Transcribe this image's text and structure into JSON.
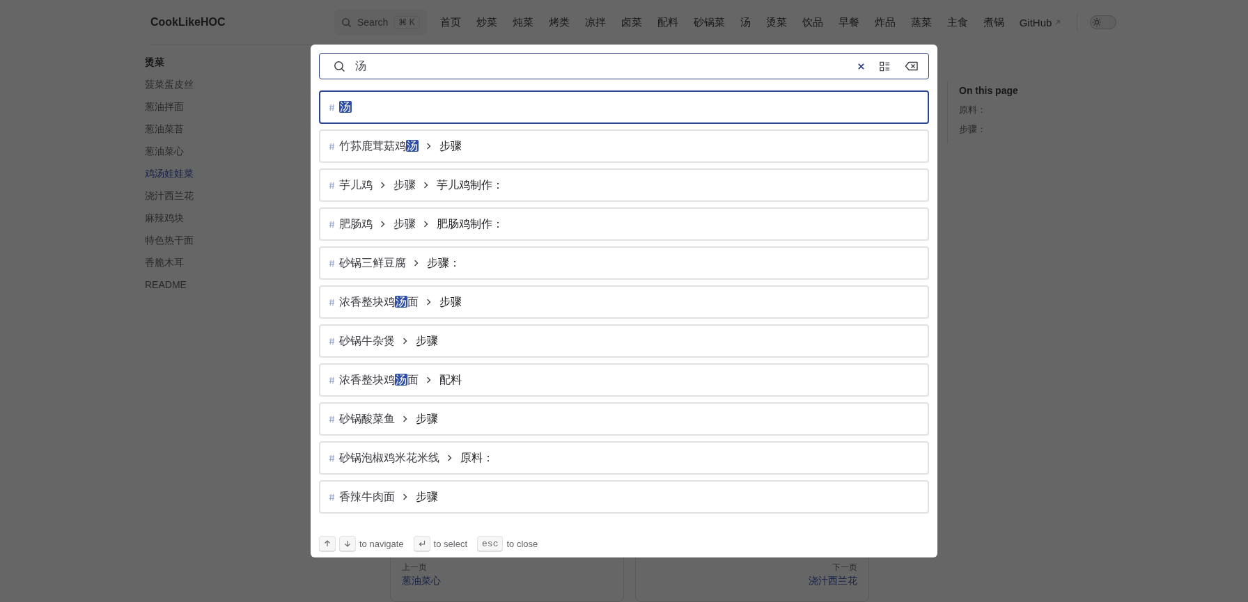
{
  "header": {
    "logo": "CookLikeHOC",
    "search": {
      "placeholder": "Search",
      "shortcut": "⌘ K"
    },
    "nav": [
      {
        "label": "首页",
        "external": false
      },
      {
        "label": "炒菜",
        "external": false
      },
      {
        "label": "炖菜",
        "external": false
      },
      {
        "label": "烤类",
        "external": false
      },
      {
        "label": "凉拌",
        "external": false
      },
      {
        "label": "卤菜",
        "external": false
      },
      {
        "label": "配料",
        "external": false
      },
      {
        "label": "砂锅菜",
        "external": false
      },
      {
        "label": "汤",
        "external": false
      },
      {
        "label": "烫菜",
        "external": false
      },
      {
        "label": "饮品",
        "external": false
      },
      {
        "label": "早餐",
        "external": false
      },
      {
        "label": "炸品",
        "external": false
      },
      {
        "label": "蒸菜",
        "external": false
      },
      {
        "label": "主食",
        "external": false
      },
      {
        "label": "煮锅",
        "external": false
      },
      {
        "label": "GitHub",
        "external": true
      }
    ],
    "theme_toggle": {
      "dark": false
    }
  },
  "sidebar": {
    "group": "烫菜",
    "items": [
      {
        "label": "菠菜蛋皮丝",
        "selected": false
      },
      {
        "label": "葱油拌面",
        "selected": false
      },
      {
        "label": "葱油菜苔",
        "selected": false
      },
      {
        "label": "葱油菜心",
        "selected": false
      },
      {
        "label": "鸡汤娃娃菜",
        "selected": true
      },
      {
        "label": "浇汁西兰花",
        "selected": false
      },
      {
        "label": "麻辣鸡块",
        "selected": false
      },
      {
        "label": "特色热干面",
        "selected": false
      },
      {
        "label": "香脆木耳",
        "selected": false
      },
      {
        "label": "README",
        "selected": false
      }
    ]
  },
  "outline": {
    "title": "On this page",
    "items": [
      "原料：",
      "步骤："
    ]
  },
  "pager": {
    "prev": {
      "label": "上一页",
      "title": "葱油菜心"
    },
    "next": {
      "label": "下一页",
      "title": "浇汁西兰花"
    }
  },
  "search_modal": {
    "query": "汤",
    "results": [
      {
        "selected": true,
        "crumbs": [
          [
            {
              "text": "汤",
              "match": true
            }
          ]
        ]
      },
      {
        "selected": false,
        "crumbs": [
          [
            {
              "text": "竹荪鹿茸菇鸡",
              "match": false
            },
            {
              "text": "汤",
              "match": true
            }
          ],
          [
            {
              "text": "步骤",
              "match": false
            }
          ]
        ]
      },
      {
        "selected": false,
        "crumbs": [
          [
            {
              "text": "芋儿鸡",
              "match": false
            }
          ],
          [
            {
              "text": "步骤",
              "match": false
            }
          ],
          [
            {
              "text": "芋儿鸡制作：",
              "match": false
            }
          ]
        ]
      },
      {
        "selected": false,
        "crumbs": [
          [
            {
              "text": "肥肠鸡",
              "match": false
            }
          ],
          [
            {
              "text": "步骤",
              "match": false
            }
          ],
          [
            {
              "text": "肥肠鸡制作：",
              "match": false
            }
          ]
        ]
      },
      {
        "selected": false,
        "crumbs": [
          [
            {
              "text": "砂锅三鲜豆腐",
              "match": false
            }
          ],
          [
            {
              "text": "步骤：",
              "match": false
            }
          ]
        ]
      },
      {
        "selected": false,
        "crumbs": [
          [
            {
              "text": "浓香整块鸡",
              "match": false
            },
            {
              "text": "汤",
              "match": true
            },
            {
              "text": "面",
              "match": false
            }
          ],
          [
            {
              "text": "步骤",
              "match": false
            }
          ]
        ]
      },
      {
        "selected": false,
        "crumbs": [
          [
            {
              "text": "砂锅牛杂煲",
              "match": false
            }
          ],
          [
            {
              "text": "步骤",
              "match": false
            }
          ]
        ]
      },
      {
        "selected": false,
        "crumbs": [
          [
            {
              "text": "浓香整块鸡",
              "match": false
            },
            {
              "text": "汤",
              "match": true
            },
            {
              "text": "面",
              "match": false
            }
          ],
          [
            {
              "text": "配料",
              "match": false
            }
          ]
        ]
      },
      {
        "selected": false,
        "crumbs": [
          [
            {
              "text": "砂锅酸菜鱼",
              "match": false
            }
          ],
          [
            {
              "text": "步骤",
              "match": false
            }
          ]
        ]
      },
      {
        "selected": false,
        "crumbs": [
          [
            {
              "text": "砂锅泡椒鸡米花米线",
              "match": false
            }
          ],
          [
            {
              "text": "原料：",
              "match": false
            }
          ]
        ]
      },
      {
        "selected": false,
        "crumbs": [
          [
            {
              "text": "香辣牛肉面",
              "match": false
            }
          ],
          [
            {
              "text": "步骤",
              "match": false
            }
          ]
        ]
      }
    ],
    "footer": [
      {
        "keys": [
          {
            "kind": "up"
          },
          {
            "kind": "down"
          }
        ],
        "label": "to navigate"
      },
      {
        "keys": [
          {
            "kind": "enter"
          }
        ],
        "label": "to select"
      },
      {
        "keys": [
          {
            "kind": "text",
            "text": "esc"
          }
        ],
        "label": "to close"
      }
    ]
  }
}
